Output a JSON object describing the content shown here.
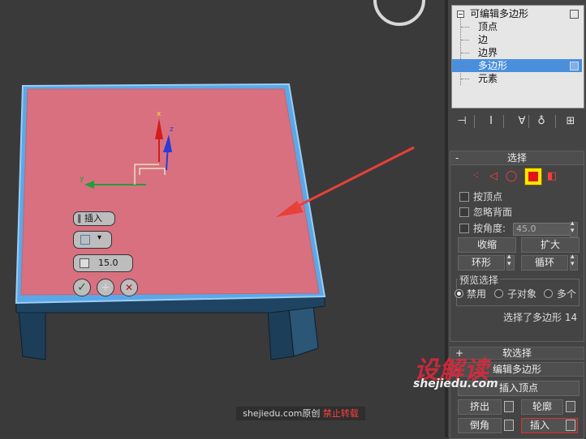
{
  "stack": {
    "items": [
      {
        "label": "可编辑多边形",
        "level": "top"
      },
      {
        "label": "顶点",
        "level": "sub"
      },
      {
        "label": "边",
        "level": "sub"
      },
      {
        "label": "边界",
        "level": "sub"
      },
      {
        "label": "多边形",
        "level": "sub",
        "selected": true
      },
      {
        "label": "元素",
        "level": "sub"
      }
    ]
  },
  "selection": {
    "title": "选择",
    "by_vertex": "按顶点",
    "ignore_backfacing": "忽略背面",
    "by_angle": "按角度:",
    "angle_value": "45.0",
    "shrink": "收缩",
    "grow": "扩大",
    "ring": "环形",
    "loop": "循环",
    "preview_title": "预览选择",
    "preview_options": [
      "禁用",
      "子对象",
      "多个"
    ],
    "status": "选择了多边形 14"
  },
  "soft_selection": {
    "title": "软选择"
  },
  "edit_polygons": {
    "title": "编辑多边形",
    "insert_vertex": "插入顶点",
    "extrude": "挤出",
    "outline": "轮廓",
    "bevel": "倒角",
    "inset": "插入"
  },
  "caddy": {
    "title": "插入",
    "amount": "15.0",
    "ok_icon": "✓",
    "apply_icon": "+",
    "cancel_icon": "✕"
  },
  "gizmo": {
    "x": "x",
    "y": "y",
    "z": "z"
  },
  "watermark": {
    "bar_site": "shejiedu.com",
    "bar_original": "原创",
    "bar_warning": "禁止转载",
    "logo": "设解读",
    "url": "shejiedu.com"
  },
  "colors": {
    "selected_face": "#d9707f",
    "box_side": "#1e3f5a",
    "edge_highlight": "#5aa8e8",
    "arrow": "#e8403a",
    "stack_selected": "#4a8fdc"
  }
}
